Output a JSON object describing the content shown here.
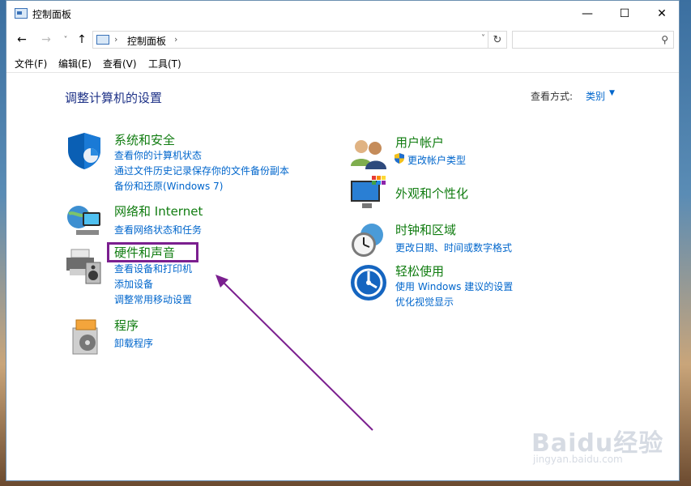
{
  "window": {
    "title": "控制面板"
  },
  "nav": {
    "back_icon": "arrow-left-icon",
    "forward_icon": "arrow-right-icon",
    "up_icon": "arrow-up-icon",
    "address_crumb": "控制面板",
    "search_placeholder": ""
  },
  "menu": [
    "文件(F)",
    "编辑(E)",
    "查看(V)",
    "工具(T)"
  ],
  "main": {
    "heading": "调整计算机的设置",
    "view_by_label": "查看方式:",
    "view_by_value": "类别"
  },
  "categories": [
    {
      "title": "系统和安全",
      "links": [
        "查看你的计算机状态",
        "通过文件历史记录保存你的文件备份副本",
        "备份和还原(Windows 7)"
      ]
    },
    {
      "title": "网络和 Internet",
      "links": [
        "查看网络状态和任务"
      ]
    },
    {
      "title": "硬件和声音",
      "links": [
        "查看设备和打印机",
        "添加设备",
        "调整常用移动设置"
      ]
    },
    {
      "title": "程序",
      "links": [
        "卸载程序"
      ]
    },
    {
      "title": "用户帐户",
      "links": [
        "更改帐户类型"
      ]
    },
    {
      "title": "外观和个性化",
      "links": []
    },
    {
      "title": "时钟和区域",
      "links": [
        "更改日期、时间或数字格式"
      ]
    },
    {
      "title": "轻松使用",
      "links": [
        "使用 Windows 建议的设置",
        "优化视觉显示"
      ]
    }
  ],
  "watermark": {
    "brand": "Baidu经验",
    "url": "jingyan.baidu.com"
  },
  "colors": {
    "category_title": "#107c10",
    "link": "#0066cc",
    "heading": "#1e3287",
    "highlight": "#7b1f8f"
  }
}
